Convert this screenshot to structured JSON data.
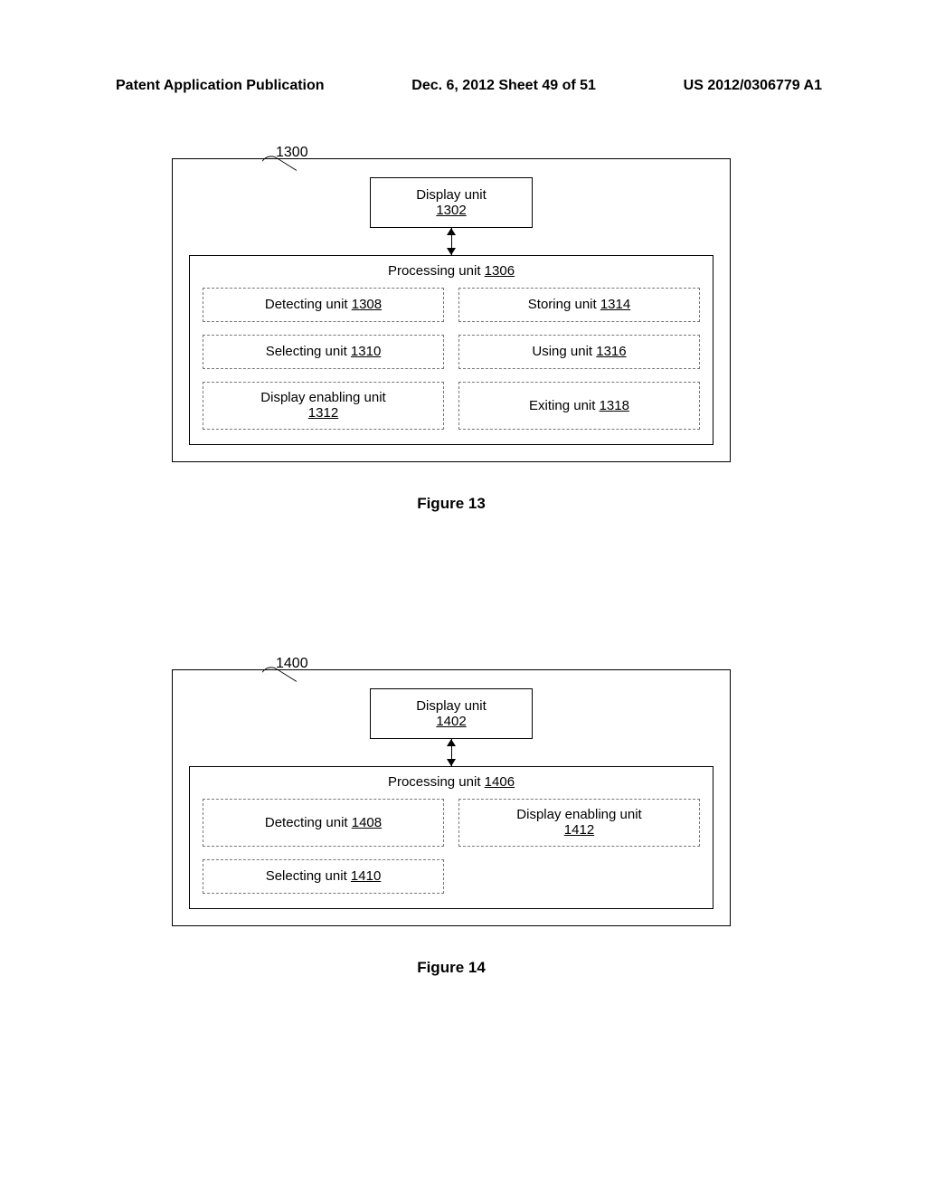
{
  "header": {
    "left": "Patent Application Publication",
    "center": "Dec. 6, 2012  Sheet 49 of 51",
    "right": "US 2012/0306779 A1"
  },
  "figures": [
    {
      "ref": "1300",
      "display_unit_label": "Display unit",
      "display_unit_num": "1302",
      "processing_label": "Processing unit ",
      "processing_num": "1306",
      "subunits": [
        {
          "label": "Detecting unit ",
          "num": "1308"
        },
        {
          "label": "Storing unit ",
          "num": "1314"
        },
        {
          "label": "Selecting unit ",
          "num": "1310"
        },
        {
          "label": "Using unit ",
          "num": "1316"
        },
        {
          "label": "Display enabling unit",
          "num": "1312",
          "stack": true
        },
        {
          "label": "Exiting unit ",
          "num": "1318"
        }
      ],
      "caption": "Figure 13"
    },
    {
      "ref": "1400",
      "display_unit_label": "Display unit",
      "display_unit_num": "1402",
      "processing_label": "Processing unit ",
      "processing_num": "1406",
      "subunits": [
        {
          "label": "Detecting unit ",
          "num": "1408"
        },
        {
          "label": "Display enabling unit",
          "num": "1412",
          "stack": true
        },
        {
          "label": "Selecting unit ",
          "num": "1410"
        }
      ],
      "caption": "Figure 14"
    }
  ]
}
